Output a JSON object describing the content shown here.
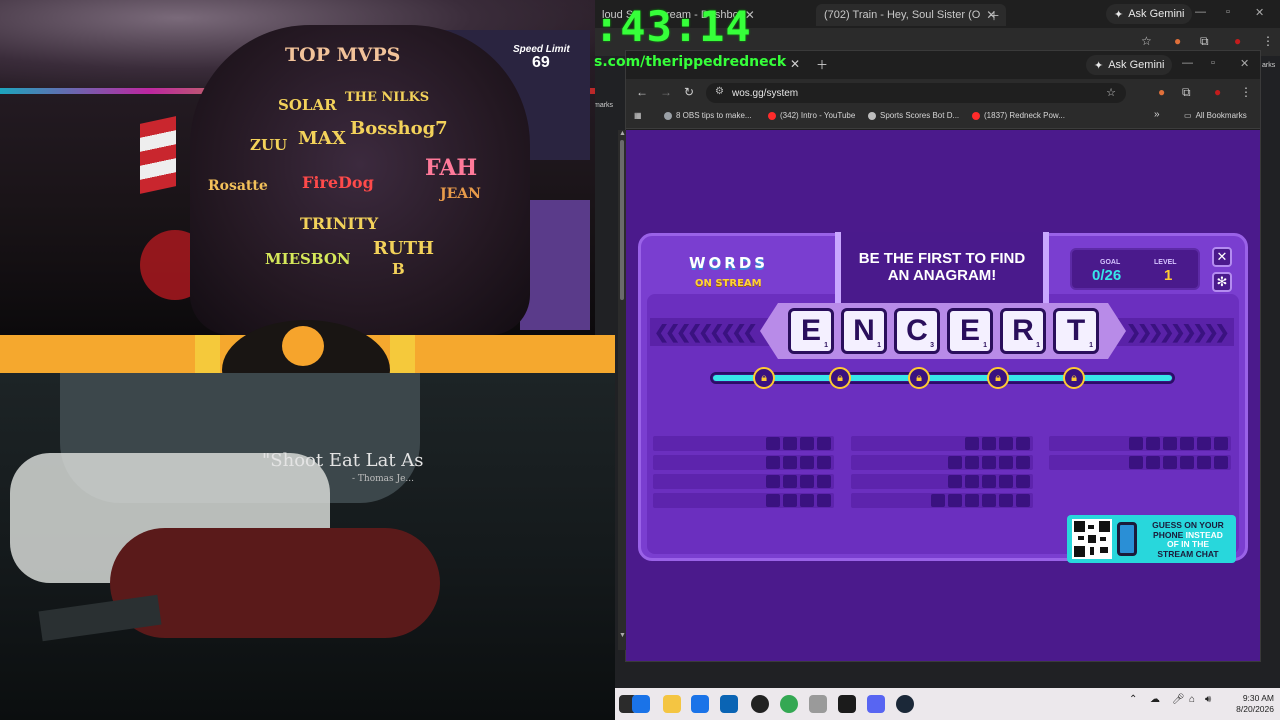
{
  "overlay": {
    "timer": ":43:14",
    "url_text": "s.com/therippedredneck"
  },
  "chair_names": {
    "header": "TOP MVPS",
    "n1": "SOLAR",
    "n2": "THE NILKS",
    "n3": "ZUU",
    "n4": "MAX",
    "n5": "Bosshog7",
    "n6": "FAH",
    "n7": "Rosatte",
    "n8": "FireDog",
    "n9": "JEAN",
    "n10": "TRINITY",
    "n11": "MIESBON",
    "n12": "RUTH",
    "n13": "B",
    "speed": "Speed Limit",
    "speed_val": "69"
  },
  "shirt": {
    "text": "\"Shoot Eat   Lat  As",
    "sub": "- Thomas Je..."
  },
  "bg_browser": {
    "tab1": "loud Str",
    "tab2": "ream - Dashbo",
    "tab3": "(702) Train - Hey, Soul Sister (O",
    "gemini": "Ask Gemini",
    "bookmarks_tail": "marks",
    "bookmarks_tail2": "arks"
  },
  "browser": {
    "gemini": "Ask Gemini",
    "url": "wos.gg/system",
    "bookmarks": [
      {
        "label": "8 OBS tips to make...",
        "color": "#9aa0a6"
      },
      {
        "label": "(342) Intro - YouTube",
        "color": "#ff2b2b"
      },
      {
        "label": "Sports Scores Bot D...",
        "color": "#bdbdbd"
      },
      {
        "label": "(1837) Redneck Pow...",
        "color": "#ff2b2b"
      }
    ],
    "all_bookmarks": "All Bookmarks"
  },
  "game": {
    "logo_top": "WORDS",
    "logo_bottom": "ON STREAM",
    "banner_line1": "BE THE FIRST TO FIND",
    "banner_line2": "AN ANAGRAM!",
    "goal_label": "GOAL",
    "goal_value": "0/26",
    "level_label": "LEVEL",
    "level_value": "1",
    "close_icon": "✕",
    "gear_icon": "✻",
    "tiles": [
      {
        "letter": "E",
        "points": "1"
      },
      {
        "letter": "N",
        "points": "1"
      },
      {
        "letter": "C",
        "points": "3"
      },
      {
        "letter": "E",
        "points": "1"
      },
      {
        "letter": "R",
        "points": "1"
      },
      {
        "letter": "T",
        "points": "1"
      }
    ],
    "progress": 0.0,
    "slot_columns": [
      [
        4,
        4,
        4,
        4
      ],
      [
        4,
        5,
        5,
        6
      ],
      [
        6,
        6
      ]
    ],
    "qr_line1": "GUESS ON YOUR",
    "qr_line2a": "PHONE",
    "qr_line2b": " INSTEAD",
    "qr_line3": "OF IN THE",
    "qr_line4": "STREAM CHAT",
    "accent_cyan": "#37e6e9",
    "accent_gold": "#ffcb32"
  },
  "taskbar": {
    "time": "9:30 AM",
    "date": "8/20/2026"
  }
}
